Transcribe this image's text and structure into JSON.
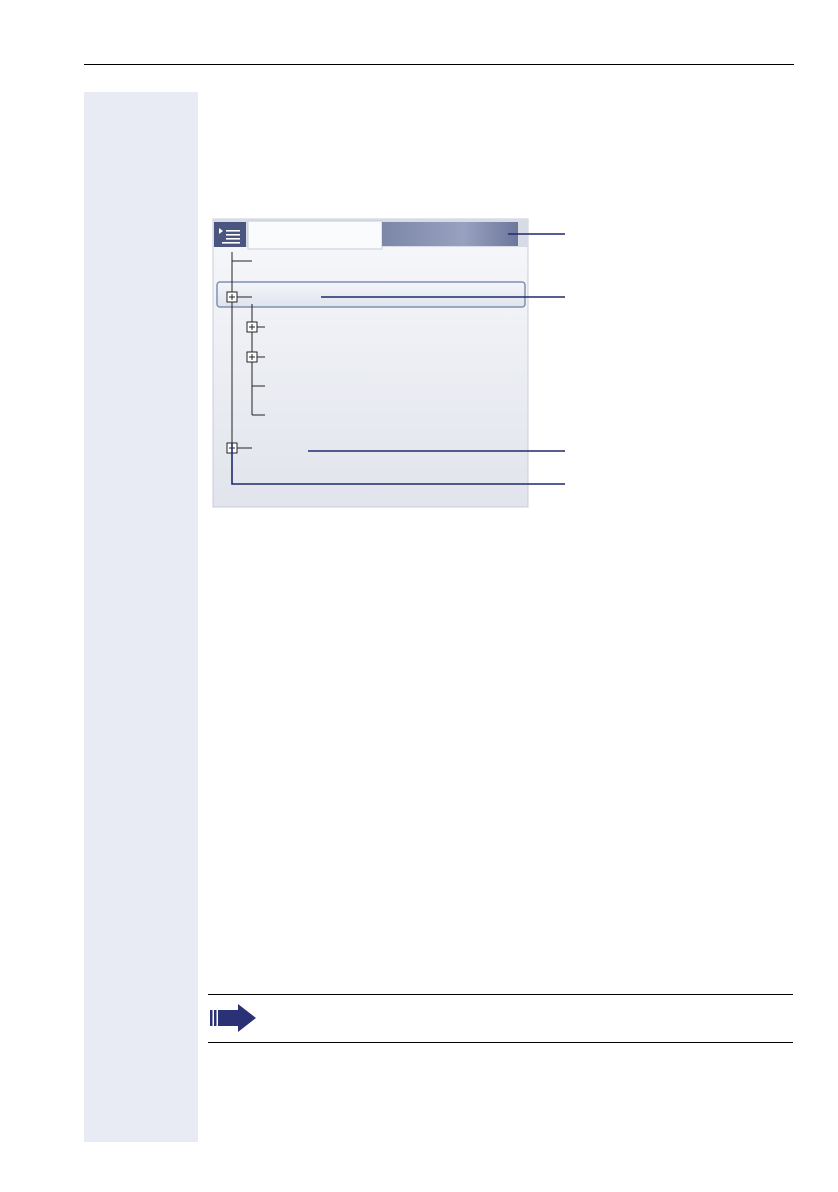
{
  "header": {
    "title": ""
  },
  "margin": {
    "color": "#e8ebf4"
  },
  "screen": {
    "menu_icon": "list-menu-icon",
    "tabs": [
      {
        "label": "",
        "active": true
      },
      {
        "label": "",
        "active": false
      }
    ],
    "tree": [
      {
        "label": "",
        "level": 0,
        "expandable": false,
        "selected": false
      },
      {
        "label": "",
        "level": 0,
        "expandable": true,
        "selected": true
      },
      {
        "label": "",
        "level": 1,
        "expandable": true,
        "selected": false
      },
      {
        "label": "",
        "level": 1,
        "expandable": true,
        "selected": false
      },
      {
        "label": "",
        "level": 1,
        "expandable": false,
        "selected": false
      },
      {
        "label": "",
        "level": 1,
        "expandable": false,
        "selected": false
      },
      {
        "label": "",
        "level": 0,
        "expandable": true,
        "selected": false
      }
    ]
  },
  "callouts": [
    "",
    "",
    "",
    ""
  ],
  "note": {
    "icon": "arrow-right-icon",
    "text": ""
  },
  "colors": {
    "callout_line": "#1f2a6b",
    "tab_inactive": "#8e97b8",
    "header_bar": "#4a5680",
    "screen_bg": "#eceff4",
    "selection_border": "#7f8fb5"
  }
}
